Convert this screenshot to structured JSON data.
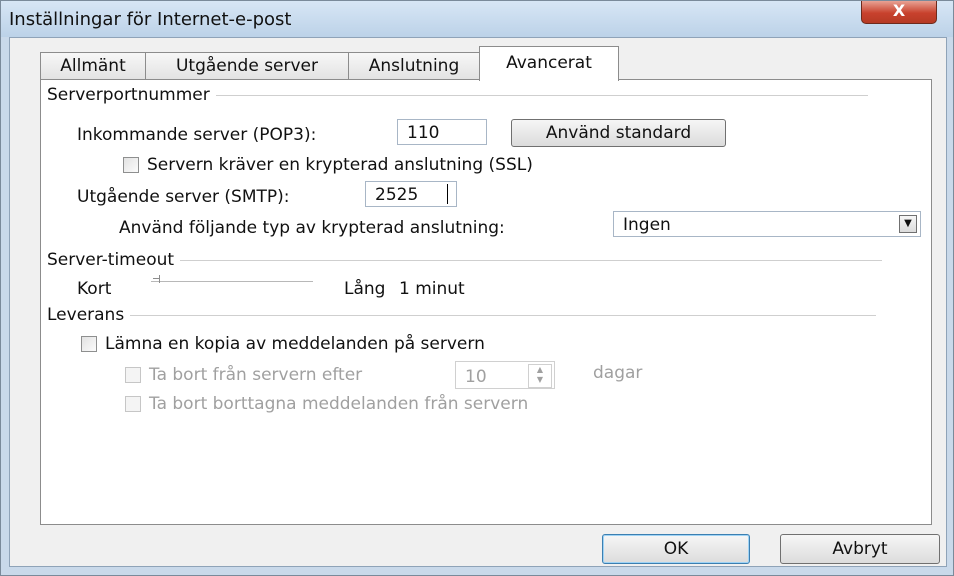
{
  "window": {
    "title": "Inställningar för Internet-e-post",
    "close_symbol": "X"
  },
  "tabs": [
    "Allmänt",
    "Utgående server",
    "Anslutning",
    "Avancerat"
  ],
  "active_tab": "Avancerat",
  "server_ports": {
    "group_title": "Serverportnummer",
    "incoming_label": "Inkommande server (POP3):",
    "incoming_value": "110",
    "use_default_label": "Använd standard",
    "ssl_label": "Servern kräver en krypterad anslutning (SSL)",
    "ssl_checked": false,
    "outgoing_label": "Utgående server (SMTP):",
    "outgoing_value": "2525",
    "encryption_label": "Använd följande typ av krypterad anslutning:",
    "encryption_value": "Ingen"
  },
  "server_timeout": {
    "group_title": "Server-timeout",
    "short_label": "Kort",
    "long_label": "Lång",
    "value_text": "1 minut",
    "slider_level": 0
  },
  "delivery": {
    "group_title": "Leverans",
    "keep_copy_label": "Lämna en kopia av meddelanden på servern",
    "keep_copy_checked": false,
    "remove_after_label": "Ta bort från servern efter",
    "remove_after_days": "10",
    "days_label": "dagar",
    "remove_deleted_label": "Ta bort borttagna meddelanden från servern"
  },
  "buttons": {
    "ok": "OK",
    "cancel": "Avbryt"
  },
  "colors": {
    "window_frame": "#c9d9ea",
    "close_button": "#c8412d",
    "dialog_background": "#f0f0f0"
  }
}
